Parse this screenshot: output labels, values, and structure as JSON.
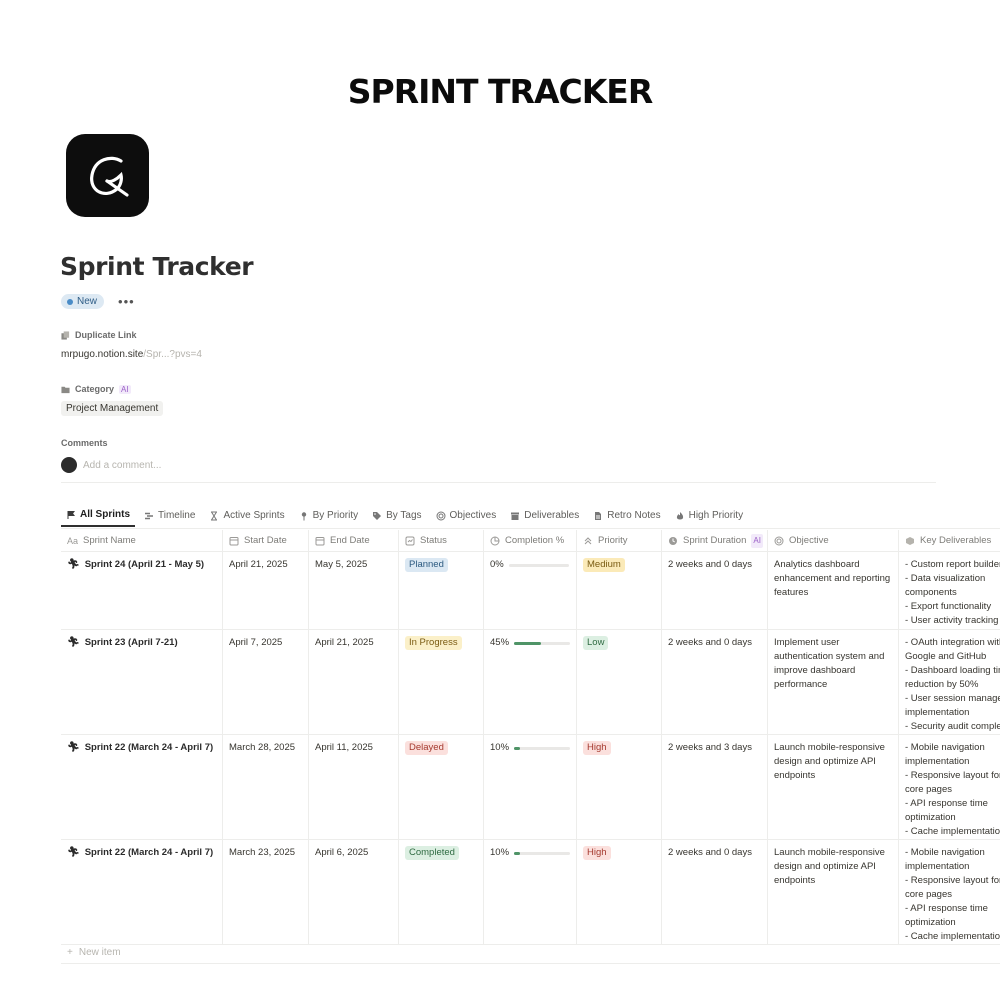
{
  "banner": {
    "title": "SPRINT TRACKER"
  },
  "page": {
    "title": "Sprint Tracker",
    "status_badge": "New",
    "more": "•••"
  },
  "properties": {
    "duplicate_link": {
      "label": "Duplicate Link",
      "value_main": "mrpugo.notion.site",
      "value_dim": "/Spr...?pvs=4"
    },
    "category": {
      "label": "Category",
      "ai": "AI",
      "value": "Project Management"
    },
    "comments": {
      "label": "Comments",
      "placeholder": "Add a comment..."
    }
  },
  "tabs": [
    {
      "label": "All Sprints",
      "icon": "flag-icon",
      "active": true
    },
    {
      "label": "Timeline",
      "icon": "timeline-icon"
    },
    {
      "label": "Active Sprints",
      "icon": "hourglass-icon"
    },
    {
      "label": "By Priority",
      "icon": "pin-icon"
    },
    {
      "label": "By Tags",
      "icon": "tag-icon"
    },
    {
      "label": "Objectives",
      "icon": "target-icon"
    },
    {
      "label": "Deliverables",
      "icon": "archive-icon"
    },
    {
      "label": "Retro Notes",
      "icon": "document-icon"
    },
    {
      "label": "High Priority",
      "icon": "fire-icon"
    }
  ],
  "table": {
    "headers": {
      "name": "Sprint Name",
      "start": "Start Date",
      "end": "End Date",
      "status": "Status",
      "completion": "Completion %",
      "priority": "Priority",
      "duration": "Sprint Duration",
      "duration_ai": "AI",
      "objective": "Objective",
      "deliverables": "Key Deliverables"
    },
    "rows": [
      {
        "name": "Sprint 24 (April 21 - May 5)",
        "start": "April 21, 2025",
        "end": "May 5, 2025",
        "status": "Planned",
        "completion_label": "0%",
        "completion": 0,
        "priority": "Medium",
        "duration": "2 weeks and 0 days",
        "objective": "Analytics dashboard enhancement and reporting features",
        "deliverables": [
          "- Custom report builder",
          "- Data visualization",
          "components",
          "- Export functionality",
          "- User activity tracking"
        ]
      },
      {
        "name": "Sprint 23 (April 7-21)",
        "start": "April 7, 2025",
        "end": "April 21, 2025",
        "status": "In Progress",
        "completion_label": "45%",
        "completion": 0.45,
        "priority": "Low",
        "duration": "2 weeks and 0 days",
        "objective": "Implement user authentication system and improve dashboard performance",
        "deliverables": [
          "- OAuth integration with",
          "Google and GitHub",
          "- Dashboard loading time",
          "reduction by 50%",
          "- User session management",
          "implementation",
          "- Security audit complete"
        ]
      },
      {
        "name": "Sprint 22 (March 24 - April 7)",
        "start": "March 28, 2025",
        "end": "April 11, 2025",
        "status": "Delayed",
        "completion_label": "10%",
        "completion": 0.1,
        "priority": "High",
        "duration": "2 weeks and 3 days",
        "objective": "Launch mobile-responsive design and optimize API endpoints",
        "deliverables": [
          "- Mobile navigation",
          "implementation",
          "- Responsive layout for",
          "core pages",
          "- API response time",
          "optimization",
          "- Cache implementation"
        ]
      },
      {
        "name": "Sprint 22 (March 24 - April 7)",
        "start": "March 23, 2025",
        "end": "April 6, 2025",
        "status": "Completed",
        "completion_label": "10%",
        "completion": 0.1,
        "priority": "High",
        "duration": "2 weeks and 0 days",
        "objective": "Launch mobile-responsive design and optimize API endpoints",
        "deliverables": [
          "- Mobile navigation",
          "implementation",
          "- Responsive layout for",
          "core pages",
          "- API response time",
          "optimization",
          "- Cache implementation"
        ]
      }
    ],
    "new_item": "New item",
    "new_item_icon": "+"
  },
  "colors": {
    "status": {
      "Planned": {
        "bg": "#dbe8f3",
        "fg": "#2c5a80"
      },
      "In Progress": {
        "bg": "#fbf0c9",
        "fg": "#7a5b12"
      },
      "Delayed": {
        "bg": "#fbe0dd",
        "fg": "#a53a2f"
      },
      "Completed": {
        "bg": "#dcefe2",
        "fg": "#2f6b42"
      }
    },
    "priority": {
      "Medium": {
        "bg": "#fbeab8",
        "fg": "#7a5b12"
      },
      "Low": {
        "bg": "#dcefe2",
        "fg": "#2f6b42"
      },
      "High": {
        "bg": "#fbe0dd",
        "fg": "#a53a2f"
      }
    }
  }
}
